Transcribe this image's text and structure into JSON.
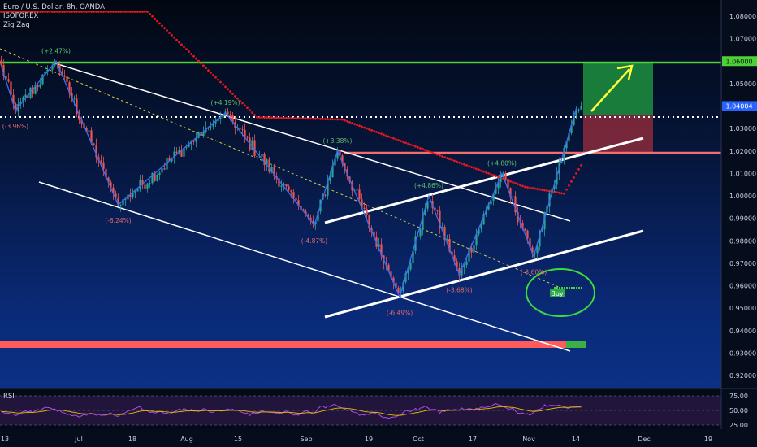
{
  "header": {
    "title": "Euro / U.S. Dollar, 8h, OANDA",
    "indicators": [
      "ISOFOREX",
      "Zig Zag"
    ]
  },
  "rsi_panel": {
    "label": "RSI",
    "levels": [
      "75.00",
      "50.00",
      "25.00"
    ]
  },
  "annotations": {
    "buy_label": "Buy",
    "target_price": "1.06000",
    "current_price": "1.04004"
  },
  "colors": {
    "bull": "#26a69a",
    "bear": "#ef5350",
    "zigzag": "#3f6cf2",
    "target_line": "#4cd137",
    "red_level": "#f26d6d",
    "trend_lines": "#ffffff",
    "ma": "#e8181e",
    "rsi": "#b04be8",
    "rsi_ma": "#e2c200"
  },
  "chart_data": {
    "type": "candlestick",
    "y_axis": {
      "ylim": [
        0.915,
        1.088
      ],
      "ticks": [
        "1.08000",
        "1.07000",
        "1.06000",
        "1.05000",
        "1.04000",
        "1.03000",
        "1.02000",
        "1.01000",
        "1.00000",
        "0.99000",
        "0.98000",
        "0.97000",
        "0.96000",
        "0.95000",
        "0.94000",
        "0.93000",
        "0.92000"
      ]
    },
    "x_axis": {
      "ticks": [
        "13",
        "Jul",
        "18",
        "Aug",
        "15",
        "Sep",
        "19",
        "Oct",
        "17",
        "Nov",
        "14",
        "Dec",
        "19"
      ]
    },
    "zigzag": [
      {
        "x": 0.0,
        "price": 1.058
      },
      {
        "x": 5.8,
        "price": 1.038,
        "label": "(-3.96%)"
      },
      {
        "x": 22.5,
        "price": 1.06,
        "label": "(+2.47%)"
      },
      {
        "x": 48.0,
        "price": 0.996,
        "label": "(-6.24%)"
      },
      {
        "x": 92.0,
        "price": 1.037,
        "label": "(+4.19%)"
      },
      {
        "x": 128.5,
        "price": 0.987,
        "label": "(-4.87%)"
      },
      {
        "x": 138.0,
        "price": 1.02,
        "label": "(+3.38%)"
      },
      {
        "x": 163.5,
        "price": 0.955,
        "label": "(-6.49%)"
      },
      {
        "x": 175.5,
        "price": 1.0,
        "label": "(+4.86%)"
      },
      {
        "x": 188.0,
        "price": 0.965,
        "label": "(-3.68%)"
      },
      {
        "x": 205.5,
        "price": 1.01,
        "label": "(+4.80%)"
      },
      {
        "x": 218.5,
        "price": 0.973,
        "label": "(-3.60%)"
      },
      {
        "x": 236.0,
        "price": 1.039
      }
    ],
    "levels": {
      "target": 1.06,
      "red_resistance": 1.02,
      "current": 1.04004
    }
  }
}
